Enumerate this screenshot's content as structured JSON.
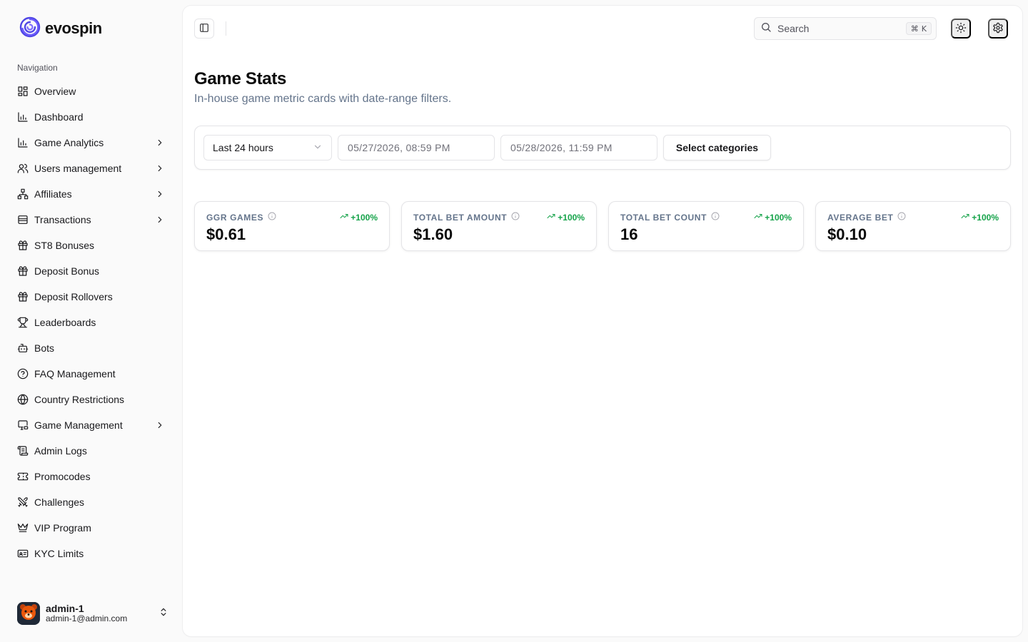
{
  "brand": {
    "name": "evospin",
    "logo_icon": "spiral-logo-icon",
    "accent": "#4f46e5"
  },
  "sidebar": {
    "heading": "Navigation",
    "items": [
      {
        "label": "Overview",
        "icon": "layout-grid-icon",
        "expandable": false
      },
      {
        "label": "Dashboard",
        "icon": "bar-chart-icon",
        "expandable": false
      },
      {
        "label": "Game Analytics",
        "icon": "bar-chart-icon",
        "expandable": true
      },
      {
        "label": "Users management",
        "icon": "users-icon",
        "expandable": true
      },
      {
        "label": "Affiliates",
        "icon": "network-icon",
        "expandable": true
      },
      {
        "label": "Transactions",
        "icon": "wallet-icon",
        "expandable": true
      },
      {
        "label": "ST8 Bonuses",
        "icon": "gift-icon",
        "expandable": false
      },
      {
        "label": "Deposit Bonus",
        "icon": "gift-icon",
        "expandable": false
      },
      {
        "label": "Deposit Rollovers",
        "icon": "gift-icon",
        "expandable": false
      },
      {
        "label": "Leaderboards",
        "icon": "trophy-icon",
        "expandable": false
      },
      {
        "label": "Bots",
        "icon": "bot-icon",
        "expandable": false
      },
      {
        "label": "FAQ Management",
        "icon": "help-circle-icon",
        "expandable": false
      },
      {
        "label": "Country Restrictions",
        "icon": "globe-icon",
        "expandable": false
      },
      {
        "label": "Game Management",
        "icon": "monitor-gamepad-icon",
        "expandable": true
      },
      {
        "label": "Admin Logs",
        "icon": "scroll-icon",
        "expandable": false
      },
      {
        "label": "Promocodes",
        "icon": "ticket-icon",
        "expandable": false
      },
      {
        "label": "Challenges",
        "icon": "swords-icon",
        "expandable": false
      },
      {
        "label": "VIP Program",
        "icon": "crown-icon",
        "expandable": false
      },
      {
        "label": "KYC Limits",
        "icon": "id-card-icon",
        "expandable": false
      }
    ]
  },
  "user": {
    "name": "admin-1",
    "email": "admin-1@admin.com",
    "avatar_icon": "bear-avatar-icon"
  },
  "topbar": {
    "search_placeholder": "Search",
    "shortcut_symbol": "⌘",
    "shortcut_key": "K"
  },
  "page": {
    "title": "Game Stats",
    "subtitle": "In-house game metric cards with date-range filters."
  },
  "filters": {
    "range_selected": "Last 24 hours",
    "start_date": "05/27/2026, 08:59 PM",
    "end_date": "05/28/2026, 11:59 PM",
    "categories_label": "Select categories"
  },
  "cards": [
    {
      "label": "GGR GAMES",
      "value": "$0.61",
      "delta": "+100%"
    },
    {
      "label": "TOTAL BET AMOUNT",
      "value": "$1.60",
      "delta": "+100%"
    },
    {
      "label": "TOTAL BET COUNT",
      "value": "16",
      "delta": "+100%"
    },
    {
      "label": "AVERAGE BET",
      "value": "$0.10",
      "delta": "+100%"
    }
  ],
  "colors": {
    "positive": "#16a34a",
    "muted": "#64748b"
  }
}
